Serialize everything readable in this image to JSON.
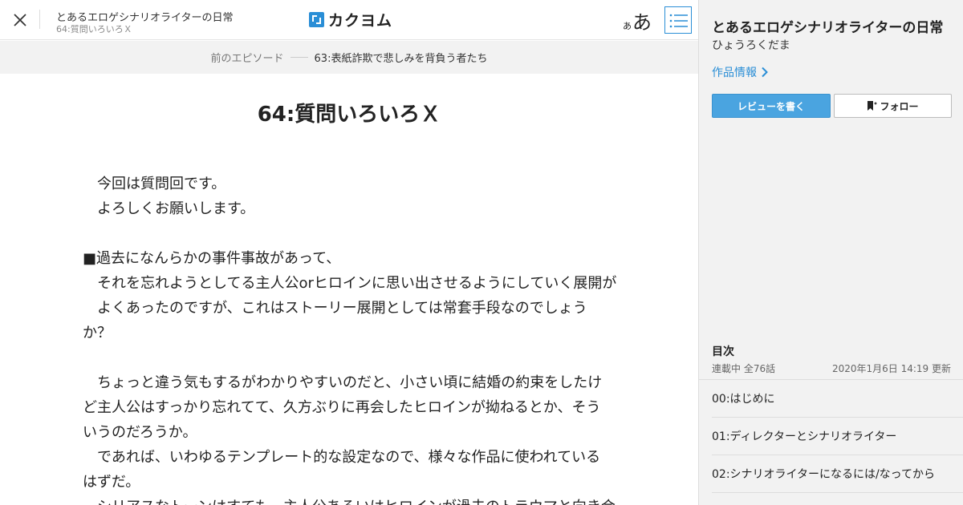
{
  "header": {
    "work_title": "とあるエロゲシナリオライターの日常",
    "episode_title": "64:質問いろいろＸ",
    "logo_text": "カクヨム",
    "font_small": "あ",
    "font_large": "あ"
  },
  "prev": {
    "label": "前のエピソード",
    "title": "63:表紙詐欺で悲しみを背負う者たち"
  },
  "episode": {
    "title": "64:質問いろいろＸ",
    "lines": [
      "　今回は質問回です。",
      "　よろしくお願いします。",
      "",
      "■過去になんらかの事件事故があって、",
      "　それを忘れようとしてる主人公orヒロインに思い出させるようにしていく展開が",
      "　よくあったのですが、これはストーリー展開としては常套手段なのでしょう",
      "か？",
      "",
      "　ちょっと違う気もするがわかりやすいのだと、小さい頃に結婚の約束をしたけ",
      "ど主人公はすっかり忘れてて、久方ぶりに再会したヒロインが拗ねるとか、そう",
      "いうのだろうか。",
      "　であれば、いわゆるテンプレート的な設定なので、様々な作品に使われている",
      "はずだ。",
      "　シリアスなトーンはすても、主人公あるいはヒロインが過去のトラウマと向き合"
    ]
  },
  "sidebar": {
    "work_title": "とあるエロゲシナリオライターの日常",
    "author": "ひょうろくだま",
    "info_link": "作品情報",
    "review_button": "レビューを書く",
    "follow_button": "フォロー",
    "toc_heading": "目次",
    "toc_status": "連載中 全76話",
    "toc_updated": "2020年1月6日 14:19 更新",
    "toc_items": [
      "00:はじめに",
      "01:ディレクターとシナリオライター",
      "02:シナリオライターになるには/なってから"
    ]
  },
  "colors": {
    "accent": "#2a8ed6",
    "review_button": "#4aa4e0",
    "sidebar_bg": "#f2f2f2"
  }
}
